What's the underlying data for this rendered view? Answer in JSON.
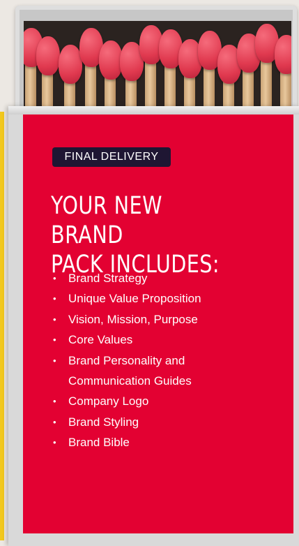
{
  "colors": {
    "accent": "#e30132",
    "badge_bg": "#1f1633",
    "text": "#ffffff",
    "yellow": "#f2c81d"
  },
  "badge": {
    "label": "FINAL DELIVERY"
  },
  "headline": {
    "line1": "YOUR NEW BRAND",
    "line2": "PACK INCLUDES:"
  },
  "list": {
    "bullet": "•",
    "items": [
      {
        "lines": [
          "Brand Strategy"
        ]
      },
      {
        "lines": [
          "Unique Value Proposition"
        ]
      },
      {
        "lines": [
          "Vision, Mission, Purpose"
        ]
      },
      {
        "lines": [
          "Core Values"
        ]
      },
      {
        "lines": [
          "Brand Personality and",
          "Communication Guides"
        ]
      },
      {
        "lines": [
          "Company Logo"
        ]
      },
      {
        "lines": [
          "Brand Styling"
        ]
      },
      {
        "lines": [
          "Brand Bible"
        ]
      }
    ]
  }
}
